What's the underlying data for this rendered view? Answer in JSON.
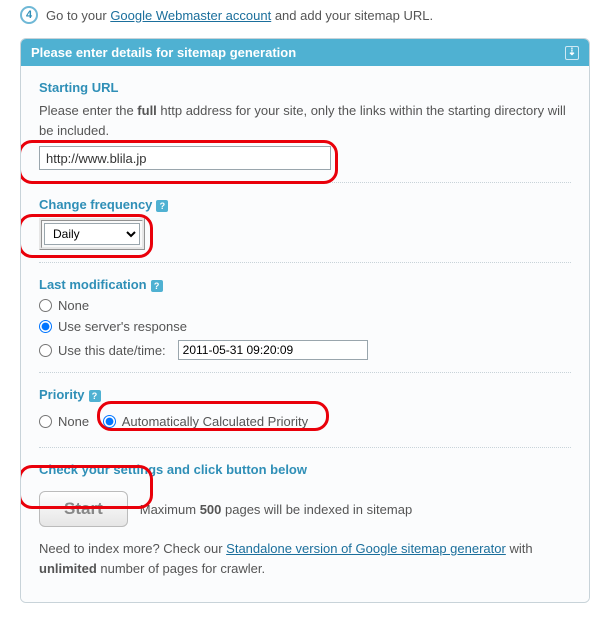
{
  "step": {
    "number": "4",
    "pre": "Go to your ",
    "link": "Google Webmaster account",
    "post": " and add your sitemap URL."
  },
  "panel": {
    "title": "Please enter details for sitemap generation"
  },
  "startingUrl": {
    "label": "Starting URL",
    "desc_pre": "Please enter the ",
    "desc_bold": "full",
    "desc_post": " http address for your site, only the links within the starting directory will be included.",
    "value": "http://www.blila.jp"
  },
  "changeFreq": {
    "label": "Change frequency",
    "value": "Daily"
  },
  "lastMod": {
    "label": "Last modification",
    "opts": {
      "none": "None",
      "server": "Use server's response",
      "date": "Use this date/time:"
    },
    "dateValue": "2011-05-31 09:20:09"
  },
  "priority": {
    "label": "Priority",
    "none": "None",
    "auto": "Automatically Calculated Priority"
  },
  "startSection": {
    "label": "Check your settings and click button below",
    "button": "Start",
    "max_pre": "Maximum ",
    "max_bold": "500",
    "max_post": " pages will be indexed in sitemap",
    "more_pre": "Need to index more? Check our ",
    "more_link": "Standalone version of Google sitemap generator",
    "more_mid": " with ",
    "more_bold": "unlimited",
    "more_post": " number of pages for crawler."
  }
}
